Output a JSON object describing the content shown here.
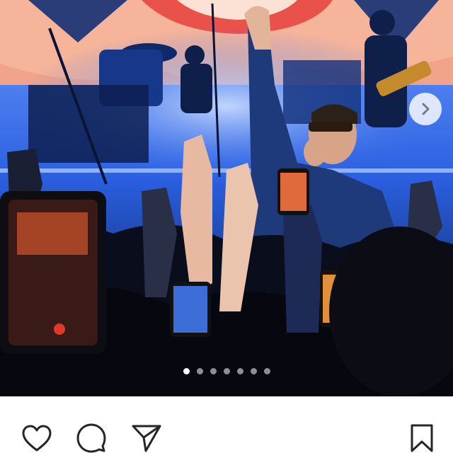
{
  "post": {
    "slide_count": 7,
    "active_slide": 1
  },
  "icons": {
    "next": "chevron-right-icon",
    "like": "heart-icon",
    "comment": "comment-bubble-icon",
    "share": "paper-plane-icon",
    "save": "bookmark-icon"
  },
  "colors": {
    "stage_blue": "#1d4fd6",
    "backdrop": "#f2a48a",
    "ui_icon": "#262626"
  }
}
